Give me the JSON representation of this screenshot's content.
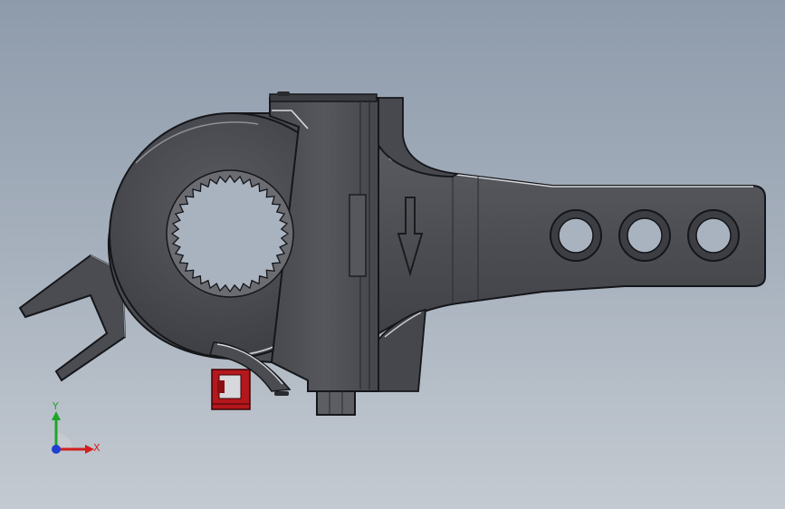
{
  "viewport": {
    "background_top": "#8e9bab",
    "background_bottom": "#c4cad1"
  },
  "model": {
    "body_color": "#4b4d52",
    "edge_color": "#1b1c1f",
    "highlight_color": "#d8dadd",
    "bolt_color": "#5c5e63",
    "clip_color": "#b4171c"
  },
  "triad": {
    "x_label": "X",
    "y_label": "Y",
    "x_color": "#d21e1e",
    "y_color": "#1ea52a",
    "z_color": "#1f3fd0"
  }
}
